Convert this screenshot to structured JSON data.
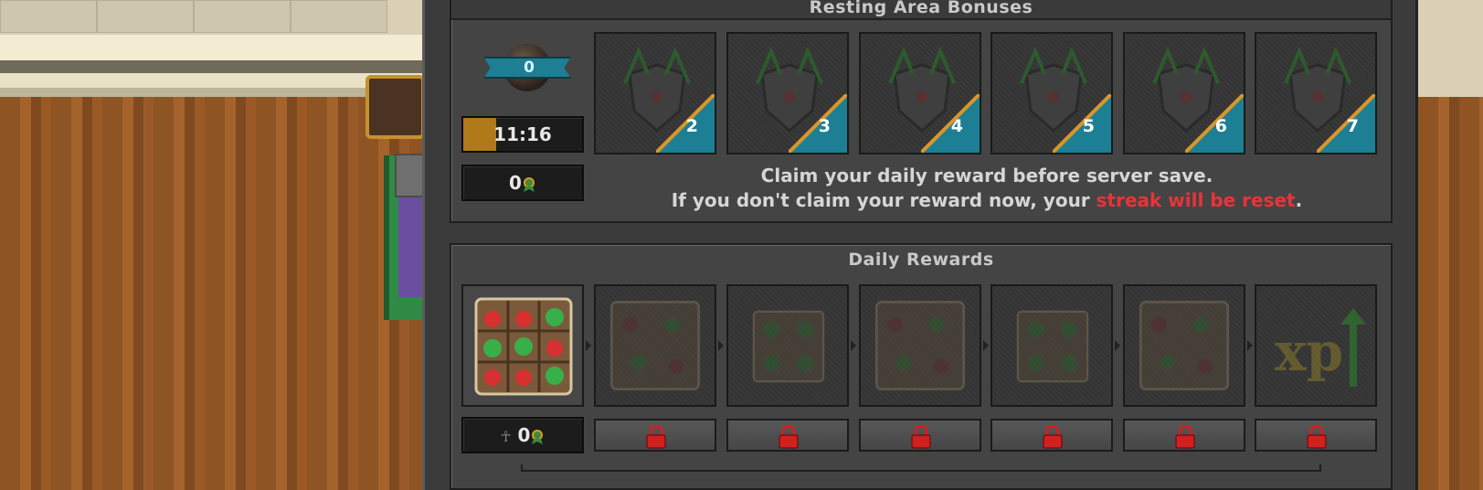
{
  "resting": {
    "title": "Resting Area Bonuses",
    "bonus_level": "0",
    "timer": "11:16",
    "timer_progress_pct": 28,
    "reward_count": "0",
    "levels": [
      "2",
      "3",
      "4",
      "5",
      "6",
      "7"
    ],
    "message_line1": "Claim your daily reward before server save.",
    "message_line2_prefix": "If you don't claim your reward now, your ",
    "message_line2_red": "streak will be reset",
    "message_line2_suffix": "."
  },
  "daily": {
    "title": "Daily Rewards",
    "jokers": "0",
    "slots": [
      {
        "icon": "potion-box-icon",
        "locked": false
      },
      {
        "icon": "potion-box-icon",
        "locked": true
      },
      {
        "icon": "potion-box-icon",
        "locked": true
      },
      {
        "icon": "potion-box-icon",
        "locked": true
      },
      {
        "icon": "potion-box-icon",
        "locked": true
      },
      {
        "icon": "potion-box-icon",
        "locked": true
      },
      {
        "icon": "xp-boost-icon",
        "locked": true,
        "label": "xp"
      }
    ]
  },
  "colors": {
    "accent_red": "#e8333a",
    "ribbon_blue": "#1d7f94",
    "timer_fill": "#b07a1a"
  }
}
